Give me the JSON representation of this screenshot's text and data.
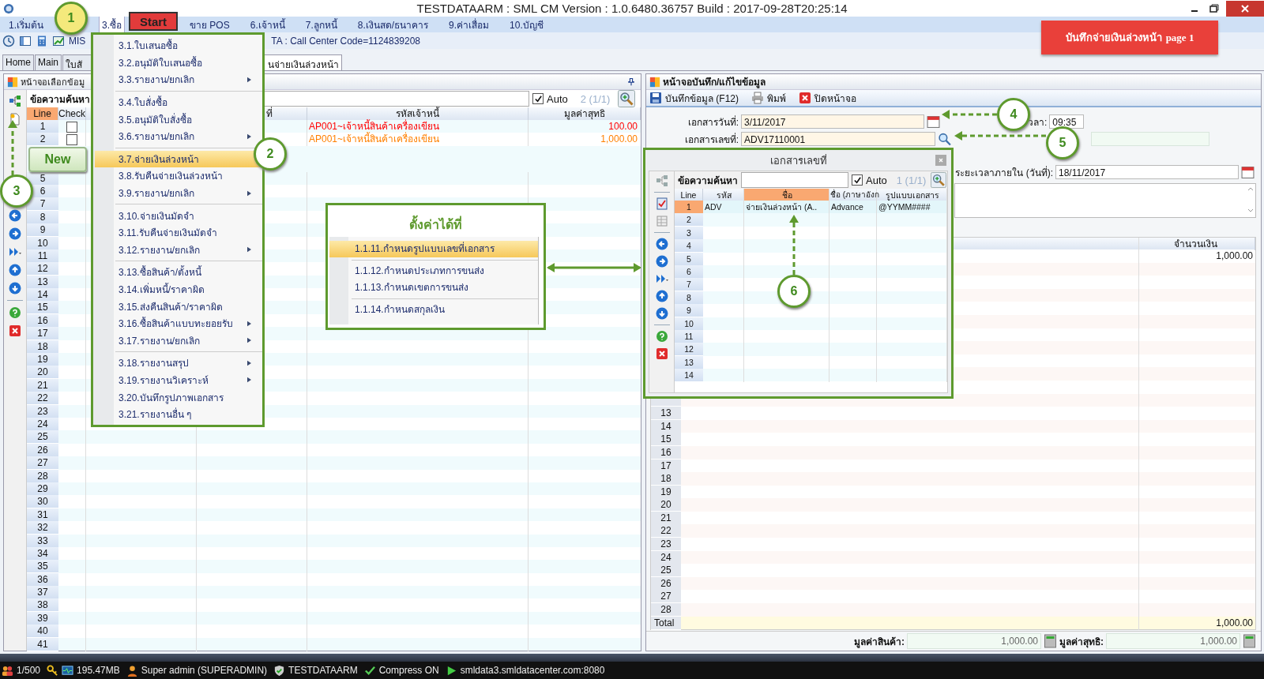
{
  "window": {
    "title": "TESTDATAARM : SML CM Version : 1.0.6480.36757  Build : 2017-09-28T20:25:14"
  },
  "menu_bar": [
    {
      "label": "1.เริ่มต้น",
      "selected": false
    },
    {
      "label": "3.ซื้อ",
      "selected": true
    },
    {
      "label": "ขาย POS",
      "selected": false
    },
    {
      "label": "6.เจ้าหนี้",
      "selected": false
    },
    {
      "label": "7.ลูกหนี้",
      "selected": false
    },
    {
      "label": "8.เงินสด/ธนาคาร",
      "selected": false
    },
    {
      "label": "9.ค่าเสื่อม",
      "selected": false
    },
    {
      "label": "10.บัญชี",
      "selected": false
    }
  ],
  "banner": "บันทึกจ่ายเงินล่วงหน้า **page 1**",
  "toolbar": {
    "mis": "MIS",
    "info": "TA : Call Center Code=1124839208"
  },
  "tabs": [
    {
      "label": "Home",
      "selected": false
    },
    {
      "label": "Main",
      "selected": false
    },
    {
      "label": "ใบสั",
      "selected": false
    },
    {
      "label": "นจ่ายเงินล่วงหน้า",
      "selected": true
    }
  ],
  "left_panel": {
    "title": "หน้าจอเลือกข้อมู",
    "search_label": "ข้อความค้นหา",
    "auto": {
      "label": "Auto",
      "checked": true
    },
    "count": "2 (1/1)",
    "columns": [
      {
        "label": "Line",
        "selected": true
      },
      {
        "label": "Check",
        "selected": false
      },
      {
        "label": "ที่",
        "selected": false
      },
      {
        "label": "รหัสเจ้าหนี้",
        "selected": false
      },
      {
        "label": "มูลค่าสุทธิ",
        "selected": false
      }
    ],
    "rows": [
      {
        "line": "1",
        "check": false,
        "creditor": "AP001~เจ้าหนี้สินค้าเครื่องเขียน",
        "amount": "100.00",
        "color": "#ff0000"
      },
      {
        "line": "2",
        "check": false,
        "creditor": "AP001~เจ้าหนี้สินค้าเครื่องเขียน",
        "amount": "1,000.00",
        "color": "#ff8000"
      },
      {
        "line": "5"
      },
      {
        "line": "6"
      },
      {
        "line": "7"
      },
      {
        "line": "8"
      },
      {
        "line": "9"
      },
      {
        "line": "10"
      },
      {
        "line": "11"
      },
      {
        "line": "12"
      },
      {
        "line": "13"
      },
      {
        "line": "14"
      },
      {
        "line": "15"
      },
      {
        "line": "16"
      },
      {
        "line": "17"
      },
      {
        "line": "18"
      },
      {
        "line": "19"
      },
      {
        "line": "20"
      },
      {
        "line": "21"
      },
      {
        "line": "22"
      },
      {
        "line": "23"
      },
      {
        "line": "24"
      },
      {
        "line": "25"
      },
      {
        "line": "26"
      },
      {
        "line": "27"
      },
      {
        "line": "28"
      },
      {
        "line": "29"
      },
      {
        "line": "30"
      },
      {
        "line": "31"
      },
      {
        "line": "32"
      },
      {
        "line": "33"
      },
      {
        "line": "34"
      },
      {
        "line": "35"
      },
      {
        "line": "36"
      },
      {
        "line": "37"
      },
      {
        "line": "38"
      },
      {
        "line": "39"
      },
      {
        "line": "40"
      },
      {
        "line": "41"
      }
    ]
  },
  "right_panel": {
    "title": "หน้าจอบันทึก/แก้ไขข้อมูล",
    "actions": [
      {
        "label": "บันทึกข้อมูล (F12)",
        "kind": "save"
      },
      {
        "label": "พิมพ์",
        "kind": "print"
      },
      {
        "label": "ปิดหน้าจอ",
        "kind": "close"
      }
    ],
    "doc_date": {
      "label": "เอกสารวันที่:",
      "value": "3/11/2017"
    },
    "doc_no": {
      "label": "เอกสารเลขที่:",
      "value": "ADV17110001"
    },
    "time": {
      "label": "วลา:",
      "value": "09:35"
    },
    "due": {
      "label": "ระยะเวลาภายใน (วันที่):",
      "value": "18/11/2017"
    },
    "grid": {
      "amount_header": "จำนวนเงิน",
      "first_amount": "1,000.00",
      "line_numbers": [
        "13",
        "14",
        "15",
        "16",
        "17",
        "18",
        "19",
        "20",
        "21",
        "22",
        "23",
        "24",
        "25",
        "26",
        "27",
        "28"
      ],
      "total_label": "Total",
      "total": "1,000.00"
    },
    "goods_value": {
      "label": "มูลค่าสินค้า:",
      "value": "1,000.00"
    },
    "net_value": {
      "label": "มูลค่าสุทธิ:",
      "value": "1,000.00"
    }
  },
  "menu": {
    "groups": [
      [
        {
          "label": "3.1.ใบเสนอซื้อ",
          "submenu": false,
          "selected": false
        },
        {
          "label": "3.2.อนุมัติใบเสนอซื้อ",
          "submenu": false,
          "selected": false
        },
        {
          "label": "3.3.รายงาน/ยกเลิก",
          "submenu": true,
          "selected": false
        }
      ],
      [
        {
          "label": "3.4.ใบสั่งซื้อ",
          "submenu": false,
          "selected": false
        },
        {
          "label": "3.5.อนุมัติใบสั่งซื้อ",
          "submenu": false,
          "selected": false
        },
        {
          "label": "3.6.รายงาน/ยกเลิก",
          "submenu": true,
          "selected": false
        }
      ],
      [
        {
          "label": "3.7.จ่ายเงินล่วงหน้า",
          "submenu": false,
          "selected": true
        },
        {
          "label": "3.8.รับคืนจ่ายเงินล่วงหน้า",
          "submenu": false,
          "selected": false
        },
        {
          "label": "3.9.รายงาน/ยกเลิก",
          "submenu": true,
          "selected": false
        }
      ],
      [
        {
          "label": "3.10.จ่ายเงินมัดจำ",
          "submenu": false,
          "selected": false
        },
        {
          "label": "3.11.รับคืนจ่ายเงินมัดจำ",
          "submenu": false,
          "selected": false
        },
        {
          "label": "3.12.รายงาน/ยกเลิก",
          "submenu": true,
          "selected": false
        }
      ],
      [
        {
          "label": "3.13.ซื้อสินค้า/ตั้งหนี้",
          "submenu": false,
          "selected": false
        },
        {
          "label": "3.14.เพิ่มหนี้/ราคาผิด",
          "submenu": false,
          "selected": false
        },
        {
          "label": "3.15.ส่งคืนสินค้า/ราคาผิด",
          "submenu": false,
          "selected": false
        },
        {
          "label": "3.16.ซื้อสินค้าแบบทะยอยรับ",
          "submenu": true,
          "selected": false
        },
        {
          "label": "3.17.รายงาน/ยกเลิก",
          "submenu": true,
          "selected": false
        }
      ],
      [
        {
          "label": "3.18.รายงานสรุป",
          "submenu": true,
          "selected": false
        },
        {
          "label": "3.19.รายงานวิเคราะห์",
          "submenu": true,
          "selected": false
        },
        {
          "label": "3.20.บันทึกรูปภาพเอกสาร",
          "submenu": false,
          "selected": false
        },
        {
          "label": "3.21.รายงานอื่น ๆ",
          "submenu": false,
          "selected": false
        }
      ]
    ]
  },
  "callout": {
    "title": "ตั้งค่าได้ที่",
    "groups": [
      [
        {
          "label": "1.1.11.กำหนดรูปแบบเลขที่เอกสาร",
          "selected": true
        }
      ],
      [
        {
          "label": "1.1.12.กำหนดประเภทการขนส่ง",
          "selected": false
        },
        {
          "label": "1.1.13.กำหนดเขตการขนส่ง",
          "selected": false
        }
      ],
      [
        {
          "label": "1.1.14.กำหนดสกุลเงิน",
          "selected": false
        }
      ]
    ]
  },
  "dialog": {
    "title": "เอกสารเลขที่",
    "search_label": "ข้อความค้นหา",
    "auto": {
      "label": "Auto",
      "checked": true
    },
    "count": "1 (1/1)",
    "columns": [
      {
        "label": "Line",
        "selected": false
      },
      {
        "label": "รหัส",
        "selected": false
      },
      {
        "label": "ชื่อ",
        "selected": true
      },
      {
        "label": "ชื่อ (ภาษาอังก",
        "selected": false
      },
      {
        "label": "รูปแบบเอกสาร",
        "selected": false
      }
    ],
    "rows": [
      {
        "line": "1",
        "selected": true,
        "code": "ADV",
        "name": "จ่ายเงินล่วงหน้า (A..",
        "name_en": "Advance",
        "format": "@YYMM####"
      },
      {
        "line": "2",
        "selected": false
      },
      {
        "line": "3",
        "selected": false
      },
      {
        "line": "4",
        "selected": false
      },
      {
        "line": "5",
        "selected": false
      },
      {
        "line": "6",
        "selected": false
      },
      {
        "line": "7",
        "selected": false
      },
      {
        "line": "8",
        "selected": false
      },
      {
        "line": "9",
        "selected": false
      },
      {
        "line": "10",
        "selected": false
      },
      {
        "line": "11",
        "selected": false
      },
      {
        "line": "12",
        "selected": false
      },
      {
        "line": "13",
        "selected": false
      },
      {
        "line": "14",
        "selected": false
      }
    ]
  },
  "annotations": {
    "steps": [
      "1",
      "2",
      "3",
      "4",
      "5",
      "6"
    ],
    "start": "Start",
    "new": "New"
  },
  "status_bar": [
    {
      "kind": "users",
      "text": "1/500"
    },
    {
      "kind": "memory",
      "text": "195.47MB"
    },
    {
      "kind": "user",
      "text": "Super admin (SUPERADMIN)"
    },
    {
      "kind": "database",
      "text": "TESTDATAARM"
    },
    {
      "kind": "check",
      "text": "Compress ON"
    },
    {
      "kind": "server",
      "text": "smldata3.smldatacenter.com:8080"
    }
  ]
}
